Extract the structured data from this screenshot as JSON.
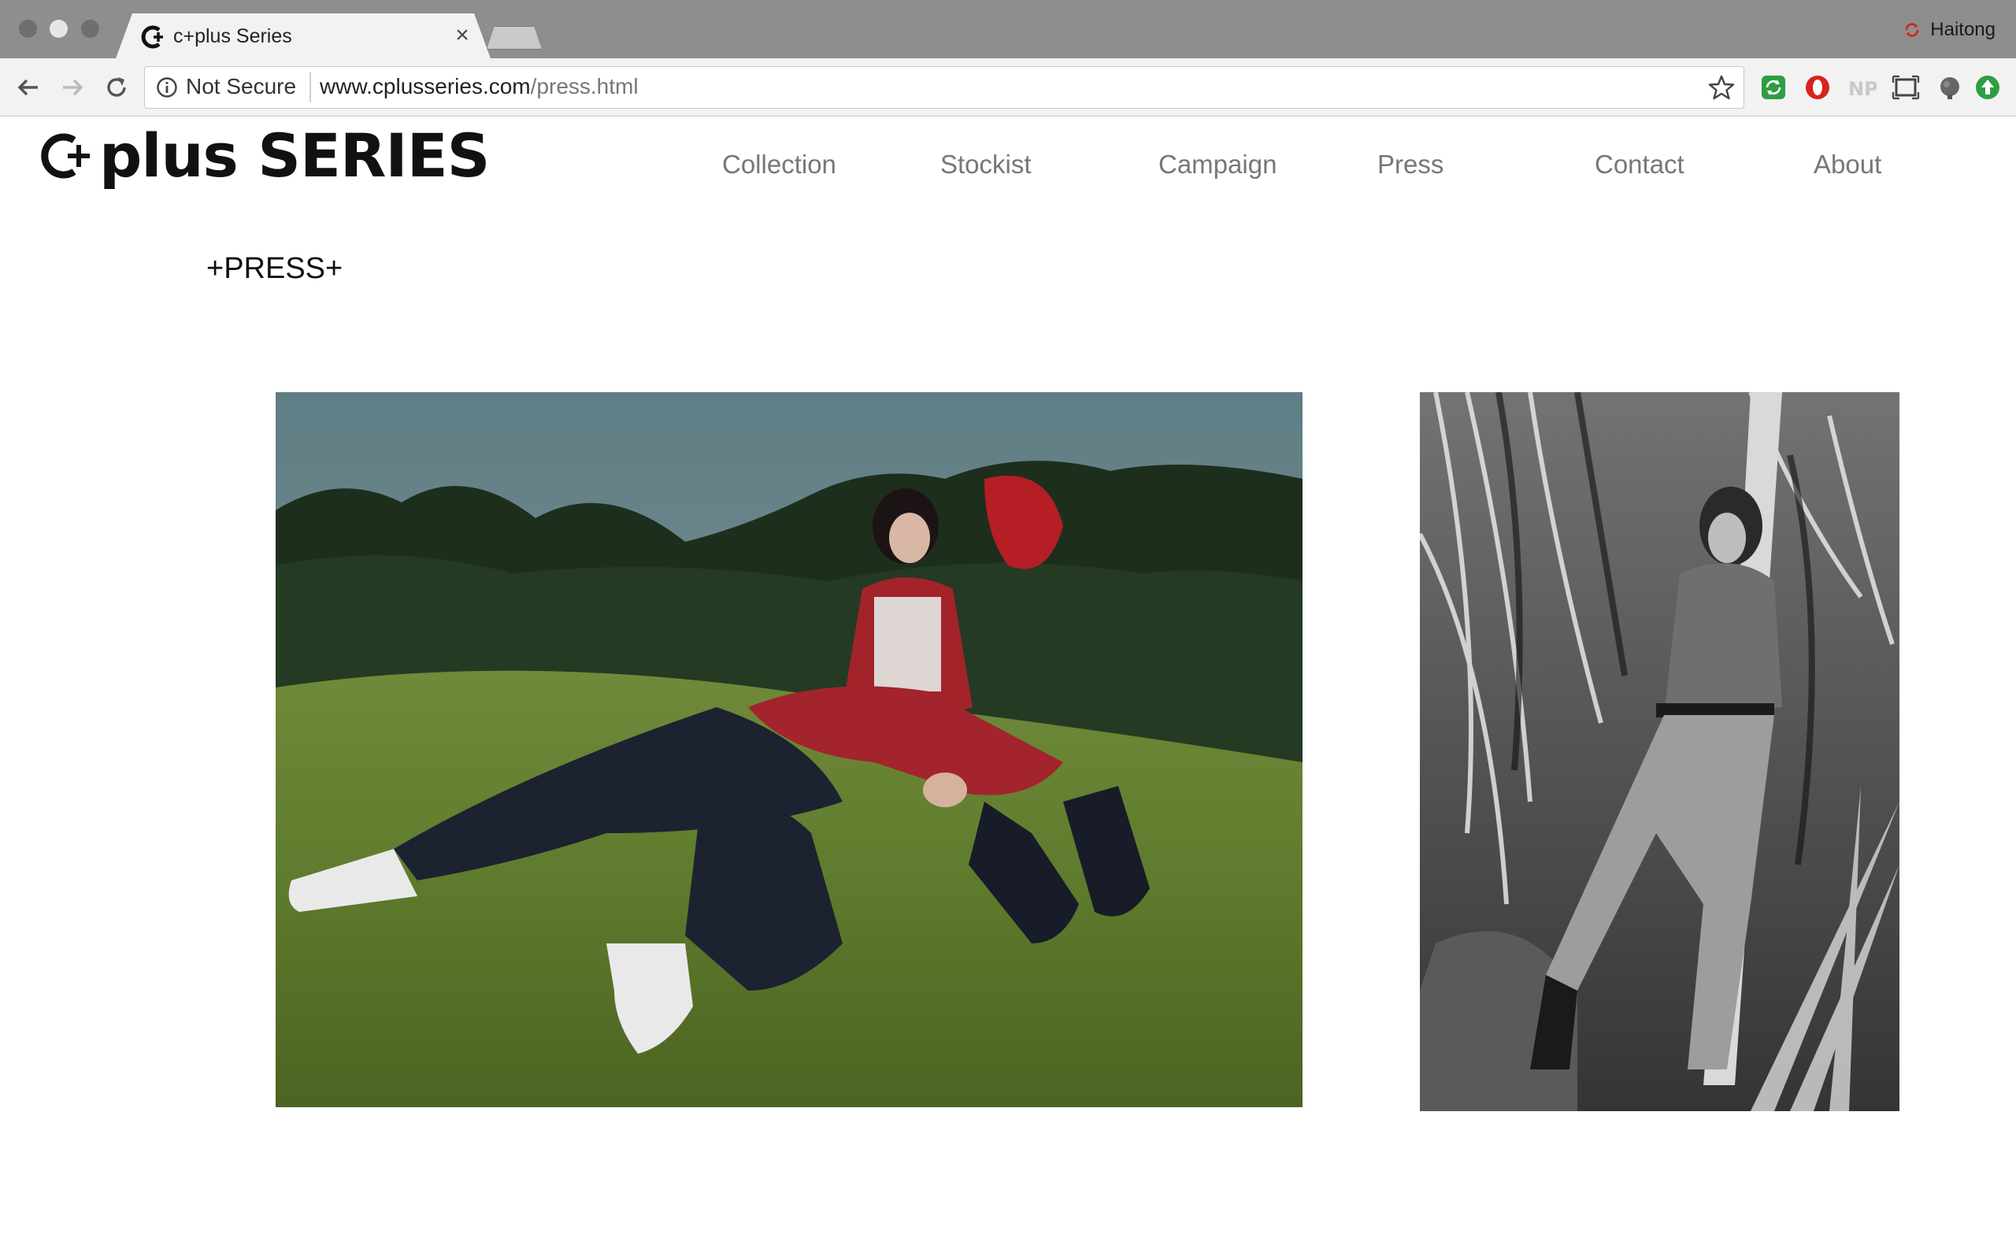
{
  "browser": {
    "tab_title": "c+plus Series",
    "tab_close": "×",
    "profile_name": "Haitong",
    "security_label": "Not Secure",
    "url_domain": "www.cplusseries.com",
    "url_path": "/press.html"
  },
  "extensions": [
    "refresh-extension-icon",
    "opera-icon",
    "np-icon",
    "screenshot-icon",
    "shield-extension-icon",
    "upload-extension-icon"
  ],
  "site": {
    "logo_text": "plus SERIES",
    "nav": [
      "Collection",
      "Stockist",
      "Campaign",
      "Press",
      "Contact",
      "About"
    ]
  },
  "press": {
    "heading": "+PRESS+",
    "photos": [
      {
        "name": "press-photo-color-grass",
        "style": "color"
      },
      {
        "name": "press-photo-bw-palms",
        "style": "black-and-white"
      }
    ]
  },
  "colors": {
    "titlebar": "#8e8e8e",
    "toolbar": "#f2f2f2",
    "nav_text": "#777777",
    "accent_green": "#2e9e43",
    "accent_red": "#d9221c"
  }
}
